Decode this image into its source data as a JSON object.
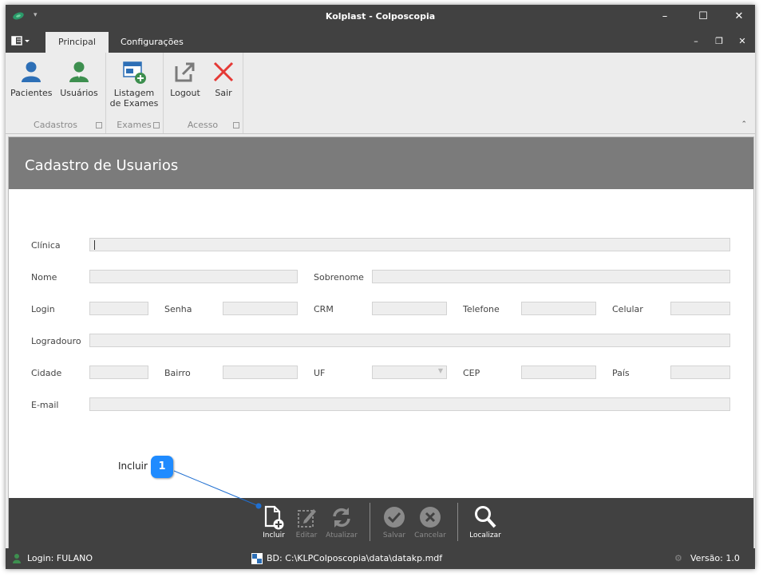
{
  "window": {
    "title": "Kolplast - Colposcopia"
  },
  "tabs": [
    {
      "label": "Principal"
    },
    {
      "label": "Configurações"
    }
  ],
  "ribbon": {
    "groups": [
      {
        "label": "Cadastros",
        "buttons": [
          {
            "label": "Pacientes",
            "icon": "user-icon"
          },
          {
            "label": "Usuários",
            "icon": "user-green-icon"
          }
        ]
      },
      {
        "label": "Exames",
        "buttons": [
          {
            "label": "Listagem\nde Exames",
            "icon": "list-add-icon"
          }
        ]
      },
      {
        "label": "Acesso",
        "buttons": [
          {
            "label": "Logout",
            "icon": "logout-icon"
          },
          {
            "label": "Sair",
            "icon": "close-red-icon"
          }
        ]
      }
    ]
  },
  "form": {
    "title": "Cadastro de Usuarios",
    "labels": {
      "clinica": "Clínica",
      "nome": "Nome",
      "sobrenome": "Sobrenome",
      "login": "Login",
      "senha": "Senha",
      "crm": "CRM",
      "telefone": "Telefone",
      "celular": "Celular",
      "logradouro": "Logradouro",
      "cidade": "Cidade",
      "bairro": "Bairro",
      "uf": "UF",
      "cep": "CEP",
      "pais": "País",
      "email": "E-mail"
    }
  },
  "toolbar": {
    "incluir": "Incluir",
    "editar": "Editar",
    "atualizar": "Atualizar",
    "salvar": "Salvar",
    "cancelar": "Cancelar",
    "localizar": "Localizar"
  },
  "callout": {
    "text": "Incluir",
    "number": "1"
  },
  "status": {
    "login": "Login: FULANO",
    "db": "BD: C:\\KLPColposcopia\\data\\datakp.mdf",
    "version": "Versão: 1.0"
  },
  "colors": {
    "titlebar": "#414141",
    "header": "#7b7b7b",
    "accent_blue": "#1f8bff",
    "red": "#e53935",
    "green": "#3d8f4f"
  }
}
